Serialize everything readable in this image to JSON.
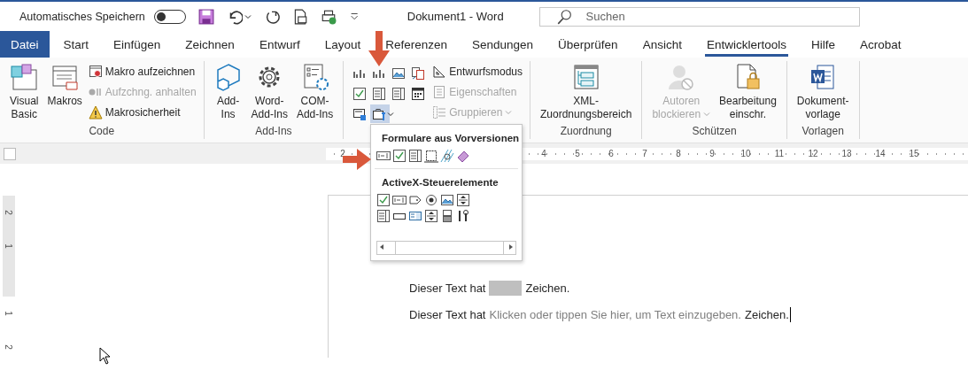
{
  "title_bar": {
    "autosave": {
      "label": "Automatisches Speichern",
      "on": false
    },
    "title": "Dokument1 - Word",
    "search": {
      "placeholder": "Suchen"
    }
  },
  "tabs": [
    {
      "label": "Datei",
      "kind": "file",
      "selected": false
    },
    {
      "label": "Start",
      "kind": "tab",
      "selected": false
    },
    {
      "label": "Einfügen",
      "kind": "tab",
      "selected": false
    },
    {
      "label": "Zeichnen",
      "kind": "tab",
      "selected": false
    },
    {
      "label": "Entwurf",
      "kind": "tab",
      "selected": false
    },
    {
      "label": "Layout",
      "kind": "tab",
      "selected": false
    },
    {
      "label": "Referenzen",
      "kind": "tab",
      "selected": false
    },
    {
      "label": "Sendungen",
      "kind": "tab",
      "selected": false
    },
    {
      "label": "Überprüfen",
      "kind": "tab",
      "selected": false
    },
    {
      "label": "Ansicht",
      "kind": "tab",
      "selected": false
    },
    {
      "label": "Entwicklertools",
      "kind": "tab",
      "selected": true
    },
    {
      "label": "Hilfe",
      "kind": "tab",
      "selected": false
    },
    {
      "label": "Acrobat",
      "kind": "tab",
      "selected": false
    }
  ],
  "ribbon": {
    "groups": [
      {
        "label": "Code",
        "items": [
          {
            "kind": "large",
            "lines": [
              "Visual",
              "Basic"
            ],
            "disabled": false,
            "dropdown": false
          },
          {
            "kind": "large",
            "lines": [
              "Makros"
            ],
            "disabled": false,
            "dropdown": false
          },
          {
            "kind": "column",
            "entries": [
              {
                "label": "Makro aufzeichnen",
                "disabled": false,
                "dropdown": false
              },
              {
                "label": "Aufzchng. anhalten",
                "disabled": true,
                "dropdown": false
              },
              {
                "label": "Makrosicherheit",
                "disabled": false,
                "dropdown": false
              }
            ]
          }
        ]
      },
      {
        "label": "Add-Ins",
        "items": [
          {
            "kind": "large",
            "lines": [
              "Add-",
              "Ins"
            ],
            "disabled": false,
            "dropdown": false
          },
          {
            "kind": "large",
            "lines": [
              "Word-",
              "Add-Ins"
            ],
            "disabled": false,
            "dropdown": false
          },
          {
            "kind": "large",
            "lines": [
              "COM-",
              "Add-Ins"
            ],
            "disabled": false,
            "dropdown": false
          }
        ]
      },
      {
        "items": [
          {
            "kind": "grid",
            "buttons": [
              {
                "selected": false,
                "dropdown": false
              },
              {
                "selected": false,
                "dropdown": false
              },
              {
                "selected": false,
                "dropdown": false
              },
              {
                "selected": false,
                "dropdown": false
              },
              {
                "selected": false,
                "dropdown": false
              },
              {
                "selected": false,
                "dropdown": false
              },
              {
                "selected": false,
                "dropdown": false
              },
              {
                "selected": false,
                "dropdown": false
              },
              {
                "selected": false,
                "dropdown": false
              },
              {
                "selected": true,
                "dropdown": true
              }
            ]
          },
          {
            "kind": "column",
            "entries": [
              {
                "label": "Entwurfsmodus",
                "disabled": false,
                "dropdown": false
              },
              {
                "label": "Eigenschaften",
                "disabled": true,
                "dropdown": false
              },
              {
                "label": "Gruppieren",
                "disabled": true,
                "dropdown": true
              }
            ]
          }
        ]
      },
      {
        "label": "Zuordnung",
        "items": [
          {
            "kind": "large",
            "lines": [
              "XML-",
              "Zuordnungsbereich"
            ],
            "disabled": false,
            "dropdown": false
          }
        ]
      },
      {
        "label": "Schützen",
        "items": [
          {
            "kind": "large",
            "lines": [
              "Autoren",
              "blockieren"
            ],
            "disabled": true,
            "dropdown": true
          },
          {
            "kind": "large",
            "lines": [
              "Bearbeitung",
              "einschr."
            ],
            "disabled": false,
            "dropdown": false
          }
        ]
      },
      {
        "label": "Vorlagen",
        "items": [
          {
            "kind": "large",
            "lines": [
              "Dokument-",
              "vorlage"
            ],
            "disabled": false,
            "dropdown": false
          }
        ]
      }
    ]
  },
  "ruler": {
    "left_numbers": [
      "2"
    ],
    "right_numbers": [
      "4",
      "5",
      "6",
      "7",
      "8",
      "9",
      "10",
      "11",
      "12",
      "13",
      "14",
      "15"
    ]
  },
  "vertical_ruler": {
    "top_numbers": [
      "2",
      "1"
    ],
    "bottom_numbers": [
      "1",
      "2"
    ]
  },
  "controls_menu": {
    "sections": [
      {
        "title": "Formulare aus Vorversionen"
      },
      {
        "title": "ActiveX-Steuerelemente"
      }
    ]
  },
  "document": {
    "lines": [
      {
        "cursor": false,
        "parts": [
          {
            "kind": "text",
            "text": "Dieser Text hat"
          },
          {
            "kind": "field"
          },
          {
            "kind": "text",
            "text": "Zeichen."
          }
        ]
      },
      {
        "cursor": true,
        "parts": [
          {
            "kind": "text",
            "text": "Dieser Text hat"
          },
          {
            "kind": "placeholder",
            "text": "Klicken oder tippen Sie hier, um Text einzugeben."
          },
          {
            "kind": "text",
            "text": "Zeichen."
          }
        ]
      }
    ]
  }
}
